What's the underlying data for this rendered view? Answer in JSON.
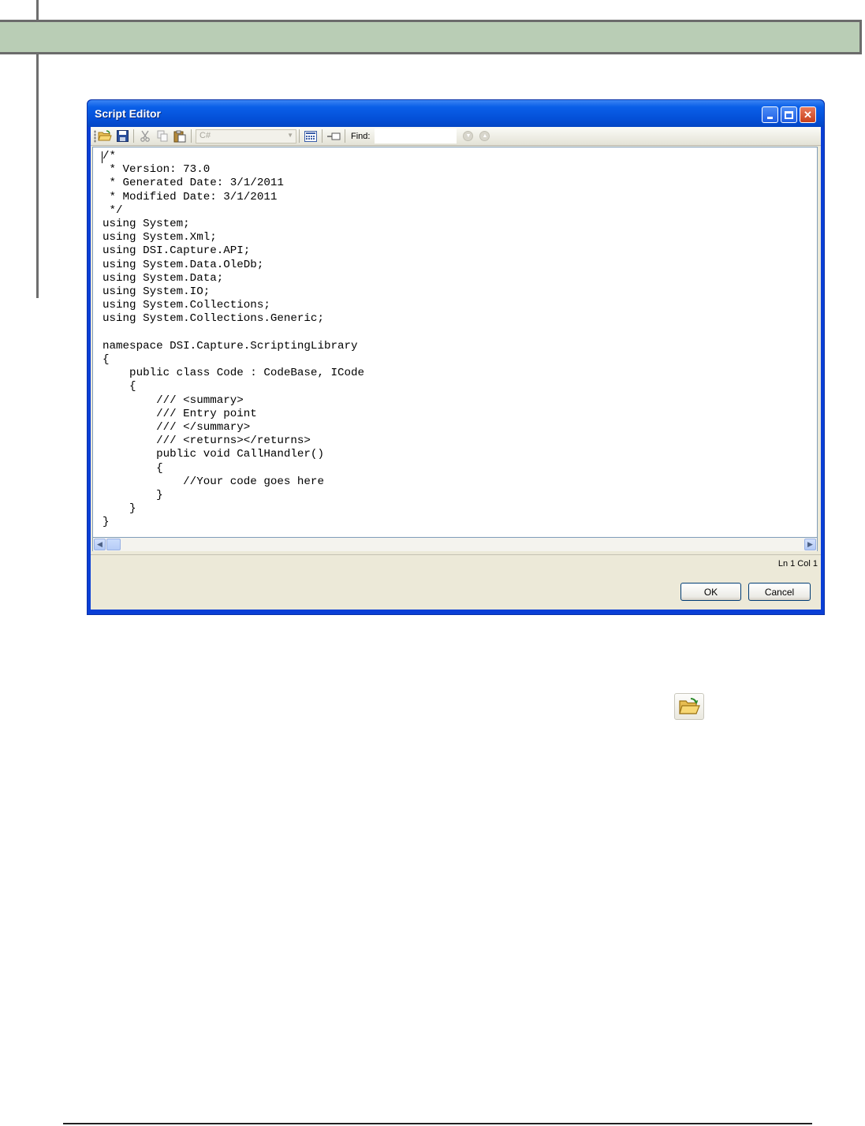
{
  "window": {
    "title": "Script Editor"
  },
  "toolbar": {
    "items": [
      "open-icon",
      "save-icon",
      "cut-icon",
      "copy-icon",
      "paste-icon",
      "language-select",
      "calculator-icon",
      "insert-icon",
      "find-field",
      "find-next-icon",
      "find-previous-icon"
    ],
    "language": "C#",
    "find_label": "Find:",
    "find_value": ""
  },
  "editor": {
    "code": "/*\n * Version: 73.0\n * Generated Date: 3/1/2011\n * Modified Date: 3/1/2011\n */\nusing System;\nusing System.Xml;\nusing DSI.Capture.API;\nusing System.Data.OleDb;\nusing System.Data;\nusing System.IO;\nusing System.Collections;\nusing System.Collections.Generic;\n\nnamespace DSI.Capture.ScriptingLibrary\n{\n    public class Code : CodeBase, ICode\n    {\n        /// <summary>\n        /// Entry point\n        /// </summary>\n        /// <returns></returns>\n        public void CallHandler()\n        {\n            //Your code goes here\n        }\n    }\n}"
  },
  "status": {
    "position": "Ln 1  Col 1"
  },
  "buttons": {
    "ok": "OK",
    "cancel": "Cancel"
  },
  "colors": {
    "titlebar": "#0a5fe8",
    "header_band": "#b9cdb5",
    "client_bg": "#ece9d8"
  }
}
